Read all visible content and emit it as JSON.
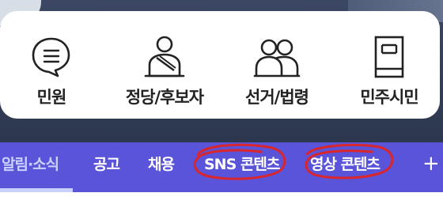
{
  "quick_menu": {
    "items": [
      {
        "label": "민원",
        "icon": "speech-bubble-icon"
      },
      {
        "label": "정당/후보자",
        "icon": "candidate-person-icon"
      },
      {
        "label": "선거/법령",
        "icon": "two-people-icon"
      },
      {
        "label": "민주시민",
        "icon": "document-icon"
      }
    ]
  },
  "nav": {
    "tabs": [
      {
        "label": "알림·소식",
        "active": true
      },
      {
        "label": "공고",
        "active": false
      },
      {
        "label": "채용",
        "active": false
      },
      {
        "label": "SNS 콘텐츠",
        "active": false
      },
      {
        "label": "영상 콘텐츠",
        "active": false
      }
    ],
    "more_label": "+"
  },
  "colors": {
    "nav_background": "#5a54da",
    "active_tab": "#c9d2ff",
    "annotation": "#d9262c"
  }
}
